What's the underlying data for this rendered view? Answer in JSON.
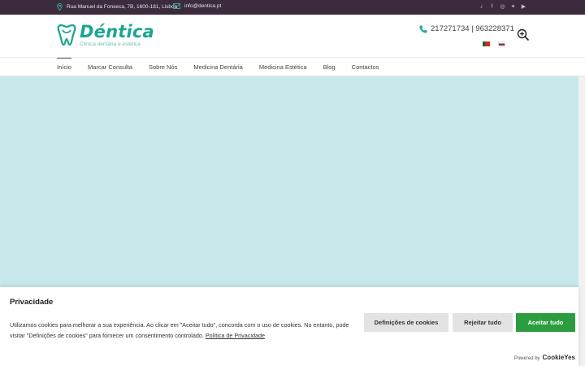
{
  "topbar": {
    "address": "Rua Manuel da Fonseca, 7B, 1600-181, Lisboa",
    "email": "info@dentica.pt",
    "social": [
      "tiktok-icon",
      "facebook-icon",
      "instagram-icon",
      "twitter-icon",
      "youtube-icon"
    ]
  },
  "header": {
    "logo_name": "Déntica",
    "logo_tagline": "Clínica dentária e estética",
    "phone": "217271734 | 963228371",
    "languages": [
      "pt",
      "ru"
    ]
  },
  "nav": {
    "items": [
      "Início",
      "Marcar Consulta",
      "Sobre Nós",
      "Medicina Dentária",
      "Medicina Estética",
      "Blog",
      "Contactos"
    ],
    "active": "Início"
  },
  "cookie": {
    "title": "Privacidade",
    "text": "Utilizamos cookies para melhorar a sua experiência. Ao clicar em \"Aceitar tudo\", concorda com o uso de cookies. No entanto, pode visitar \"Definições de cookies\" para fornecer um consentimento controlado.",
    "policy_link": "Política de Privacidade",
    "settings_label": "Definições de cookies",
    "reject_label": "Rejeitar tudo",
    "accept_label": "Aceitar tudo",
    "powered_by": "Powered by",
    "powered_brand": "CookieYes"
  },
  "colors": {
    "topbar": "#3b2b3d",
    "brand": "#1aa593",
    "hero": "#c7e8ea",
    "accept": "#2c9d3f"
  }
}
